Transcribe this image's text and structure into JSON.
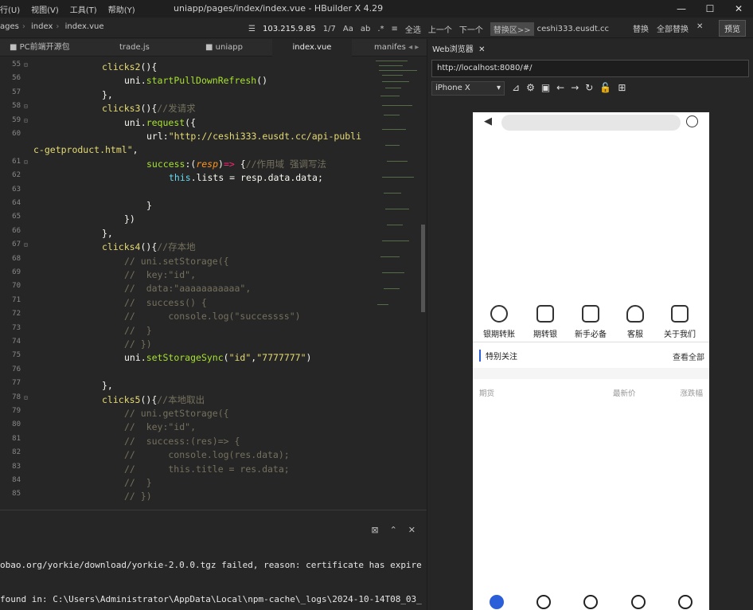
{
  "titlebar": {
    "menus": [
      "行(U)",
      "视图(V)",
      "工具(T)",
      "帮助(Y)"
    ],
    "title": "uniapp/pages/index/index.vue - HBuilder X 4.29",
    "min": "—",
    "max": "☐",
    "close": "✕"
  },
  "toolbar": {
    "crumbs": [
      "ages",
      "index",
      "index.vue"
    ],
    "ip": "103.215.9.85",
    "find_page": "1/7",
    "opt_case": "Aa",
    "opt_word": "ab",
    "opt_regex": ".*",
    "sel_all": "全选",
    "prev": "上一个",
    "next": "下一个",
    "replace_area": "替换区>>",
    "replace_value": "ceshi333.eusdt.cc",
    "replace": "替换",
    "replace_all": "全部替换",
    "close": "✕",
    "preview": "预览"
  },
  "tabs": [
    {
      "label": "PC前端开源包"
    },
    {
      "label": "trade.js"
    },
    {
      "label": "uniapp"
    },
    {
      "label": "index.vue"
    },
    {
      "label": "manifes"
    }
  ],
  "editor": {
    "lines": [
      {
        "n": "55",
        "fold": "⊟",
        "html": "<span class='kw'>clicks2</span><span class='pl'>(){</span>",
        "indent": 86
      },
      {
        "n": "56",
        "fold": "",
        "html": "<span class='pl'>uni.</span><span class='fn'>startPullDownRefresh</span><span class='pl'>()</span>",
        "indent": 114
      },
      {
        "n": "57",
        "fold": "",
        "html": "<span class='pl'>},</span>",
        "indent": 86
      },
      {
        "n": "58",
        "fold": "⊟",
        "html": "<span class='kw'>clicks3</span><span class='pl'>(){</span><span class='cm'>//发请求</span>",
        "indent": 86
      },
      {
        "n": "59",
        "fold": "⊟",
        "html": "<span class='pl'>uni.</span><span class='fn'>request</span><span class='pl'>({</span>",
        "indent": 114
      },
      {
        "n": "60",
        "fold": "",
        "html": "<span class='pl'>url:</span><span class='str'>\"http://ceshi333.eusdt.cc/api-publi</span>",
        "indent": 142
      },
      {
        "n": "",
        "fold": "",
        "html": "<span class='str'>c-getproduct.html\"</span><span class='pl'>,</span>",
        "indent": 0
      },
      {
        "n": "61",
        "fold": "⊟",
        "html": "<span class='fn'>success</span><span class='pl'>:(</span><span class='pr'>resp</span><span class='pl'>)</span><span class='op'>=&gt;</span><span class='pl'> {</span><span class='cm'>//作用域 强调写法</span>",
        "indent": 142
      },
      {
        "n": "62",
        "fold": "",
        "html": "<span class='bl'>this</span><span class='pl'>.lists = resp.data.data;</span>",
        "indent": 170
      },
      {
        "n": "63",
        "fold": "",
        "html": "",
        "indent": 170
      },
      {
        "n": "64",
        "fold": "",
        "html": "<span class='pl'>}</span>",
        "indent": 142
      },
      {
        "n": "65",
        "fold": "",
        "html": "<span class='pl'>})</span>",
        "indent": 114
      },
      {
        "n": "66",
        "fold": "",
        "html": "<span class='pl'>},</span>",
        "indent": 86
      },
      {
        "n": "67",
        "fold": "⊟",
        "html": "<span class='kw'>clicks4</span><span class='pl'>(){</span><span class='cm'>//存本地</span>",
        "indent": 86
      },
      {
        "n": "68",
        "fold": "",
        "html": "<span class='cm'>// uni.setStorage({</span>",
        "indent": 114
      },
      {
        "n": "69",
        "fold": "",
        "html": "<span class='cm'>//  key:\"id\",</span>",
        "indent": 114
      },
      {
        "n": "70",
        "fold": "",
        "html": "<span class='cm'>//  data:\"aaaaaaaaaaa\",</span>",
        "indent": 114
      },
      {
        "n": "71",
        "fold": "",
        "html": "<span class='cm'>//  success() {</span>",
        "indent": 114
      },
      {
        "n": "72",
        "fold": "",
        "html": "<span class='cm'>//      console.log(\"successss\")</span>",
        "indent": 114
      },
      {
        "n": "73",
        "fold": "",
        "html": "<span class='cm'>//  }</span>",
        "indent": 114
      },
      {
        "n": "74",
        "fold": "",
        "html": "<span class='cm'>// })</span>",
        "indent": 114
      },
      {
        "n": "75",
        "fold": "",
        "html": "<span class='pl'>uni.</span><span class='fn'>setStorageSync</span><span class='pl'>(</span><span class='str'>\"id\"</span><span class='pl'>,</span><span class='str'>\"7777777\"</span><span class='pl'>)</span>",
        "indent": 114
      },
      {
        "n": "76",
        "fold": "",
        "html": "",
        "indent": 114
      },
      {
        "n": "77",
        "fold": "",
        "html": "<span class='pl'>},</span>",
        "indent": 86
      },
      {
        "n": "78",
        "fold": "⊟",
        "html": "<span class='kw'>clicks5</span><span class='pl'>(){</span><span class='cm'>//本地取出</span>",
        "indent": 86
      },
      {
        "n": "79",
        "fold": "",
        "html": "<span class='cm'>// uni.getStorage({</span>",
        "indent": 114
      },
      {
        "n": "80",
        "fold": "",
        "html": "<span class='cm'>//  key:\"id\",</span>",
        "indent": 114
      },
      {
        "n": "81",
        "fold": "",
        "html": "<span class='cm'>//  success:(res)=&gt; {</span>",
        "indent": 114
      },
      {
        "n": "82",
        "fold": "",
        "html": "<span class='cm'>//      console.log(res.data);</span>",
        "indent": 114
      },
      {
        "n": "83",
        "fold": "",
        "html": "<span class='cm'>//      this.title = res.data;</span>",
        "indent": 114
      },
      {
        "n": "84",
        "fold": "",
        "html": "<span class='cm'>//  }</span>",
        "indent": 114
      },
      {
        "n": "85",
        "fold": "",
        "html": "<span class='cm'>// })</span>",
        "indent": 114
      }
    ]
  },
  "console": {
    "lines": [
      "obao.org/yorkie/download/yorkie-2.0.0.tgz failed, reason: certificate has expire",
      "found in: C:\\Users\\Administrator\\AppData\\Local\\npm-cache\\_logs\\2024-10-14T08_03_"
    ]
  },
  "browser": {
    "tab": "Web浏览器",
    "close": "✕",
    "url": "http://localhost:8080/#/",
    "device": "iPhone X",
    "phone": {
      "nav": [
        "银期转账",
        "期转银",
        "新手必备",
        "客服",
        "关于我们"
      ],
      "section_title": "特别关注",
      "section_link": "查看全部",
      "cols": [
        "期货",
        "最新价",
        "涨跌幅"
      ]
    }
  }
}
